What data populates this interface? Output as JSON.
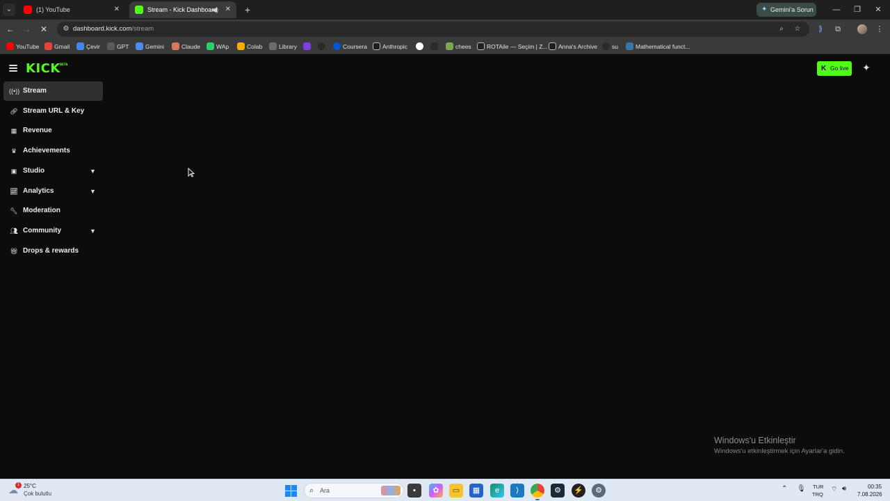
{
  "browser": {
    "tabs": [
      {
        "title": "(1) YouTube",
        "favicon": "youtube-icon"
      },
      {
        "title": "Stream - Kick Dashboard",
        "favicon": "kick-icon"
      }
    ],
    "new_tab_icon": "+",
    "gemini_button": "Gemini'a Sorun",
    "url_host": "dashboard.kick.com",
    "url_path": "/stream",
    "bookmarks": [
      {
        "label": "YouTube",
        "color": "#ff0000"
      },
      {
        "label": "Gmail",
        "color": "#ea4335"
      },
      {
        "label": "Çevir",
        "color": "#4285f4"
      },
      {
        "label": "GPT",
        "color": "#5a5a5a"
      },
      {
        "label": "Gemini",
        "color": "#4b8bf5"
      },
      {
        "label": "Claude",
        "color": "#d97757"
      },
      {
        "label": "WAp",
        "color": "#25d366"
      },
      {
        "label": "Colab",
        "color": "#f9ab00"
      },
      {
        "label": "Library",
        "color": "#6b6b6b"
      },
      {
        "label": "",
        "color": "#7b3fe4"
      },
      {
        "label": "",
        "color": "#2b2b2b"
      },
      {
        "label": "Coursera",
        "color": "#0056d2"
      },
      {
        "label": "Anthropic",
        "color": "#1f1f1f"
      },
      {
        "label": "",
        "color": "#ffffff"
      },
      {
        "label": "",
        "color": "#2b2b2b"
      },
      {
        "label": "chees",
        "color": "#7fa650"
      },
      {
        "label": "ROTAile — Seçim | Z...",
        "color": "#1f1f1f"
      },
      {
        "label": "Anna's Archive",
        "color": "#1f1f1f"
      },
      {
        "label": "su",
        "color": "#2b2b2b"
      },
      {
        "label": "Mathematical funct...",
        "color": "#3776ab"
      }
    ]
  },
  "kick": {
    "logo": "KICK",
    "logo_badge": "BETA",
    "golive_label": "Go live",
    "sidebar": [
      {
        "label": "Stream",
        "icon": "broadcast-icon",
        "active": true,
        "expandable": false
      },
      {
        "label": "Stream URL & Key",
        "icon": "link-icon",
        "active": false,
        "expandable": false
      },
      {
        "label": "Revenue",
        "icon": "chart-icon",
        "active": false,
        "expandable": false
      },
      {
        "label": "Achievements",
        "icon": "trophy-icon",
        "active": false,
        "expandable": false
      },
      {
        "label": "Studio",
        "icon": "studio-icon",
        "active": false,
        "expandable": true
      },
      {
        "label": "Analytics",
        "icon": "analytics-icon",
        "active": false,
        "expandable": true
      },
      {
        "label": "Moderation",
        "icon": "wrench-icon",
        "active": false,
        "expandable": false
      },
      {
        "label": "Community",
        "icon": "community-icon",
        "active": false,
        "expandable": true
      },
      {
        "label": "Drops & rewards",
        "icon": "gift-icon",
        "active": false,
        "expandable": false
      }
    ],
    "accent": "#53fc18"
  },
  "windows_activation": {
    "title": "Windows'u Etkinleştir",
    "subtitle": "Windows'u etkinleştirmek için Ayarlar'a gidin."
  },
  "taskbar": {
    "weather_temp": "25°C",
    "weather_desc": "Çok bulutlu",
    "weather_badge": "1",
    "search_placeholder": "Ara",
    "lang_line1": "TUR",
    "lang_line2": "TRQ",
    "time": "00:35",
    "date": "7.08.2026"
  }
}
